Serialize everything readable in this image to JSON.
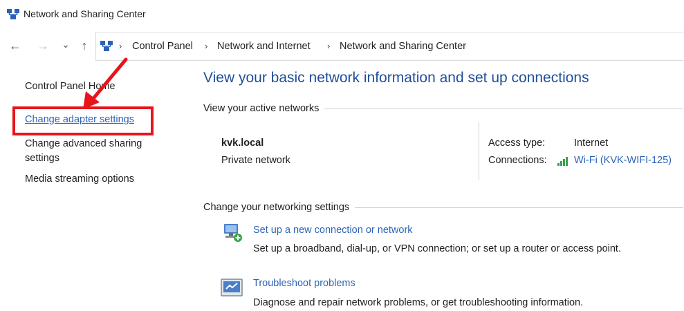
{
  "window": {
    "title": "Network and Sharing Center",
    "icon": "network-icon"
  },
  "nav": {
    "back_icon": "←",
    "forward_icon": "→",
    "recent_icon": "⌄",
    "up_icon": "↑"
  },
  "breadcrumb": {
    "items": [
      "Control Panel",
      "Network and Internet",
      "Network and Sharing Center"
    ],
    "separator": "›"
  },
  "sidebar": {
    "home_label": "Control Panel Home",
    "items": [
      {
        "label": "Change adapter settings"
      },
      {
        "label": "Change advanced sharing\nsettings"
      },
      {
        "label": "Media streaming options"
      }
    ]
  },
  "main": {
    "heading": "View your basic network information and set up connections",
    "active_networks_title": "View your active networks",
    "network": {
      "name": "kvk.local",
      "type": "Private network",
      "access_type_label": "Access type:",
      "access_type_value": "Internet",
      "connections_label": "Connections:",
      "connection_link": "Wi-Fi (KVK-WIFI-125)"
    },
    "settings_title": "Change your networking settings",
    "tasks": [
      {
        "link": "Set up a new connection or network",
        "description": "Set up a broadband, dial-up, or VPN connection; or set up a router or access point.",
        "icon": "new-connection-icon"
      },
      {
        "link": "Troubleshoot problems",
        "description": "Diagnose and repair network problems, or get troubleshooting information.",
        "icon": "troubleshoot-icon"
      }
    ]
  },
  "annotation": {
    "highlight_color": "#e8141c"
  }
}
